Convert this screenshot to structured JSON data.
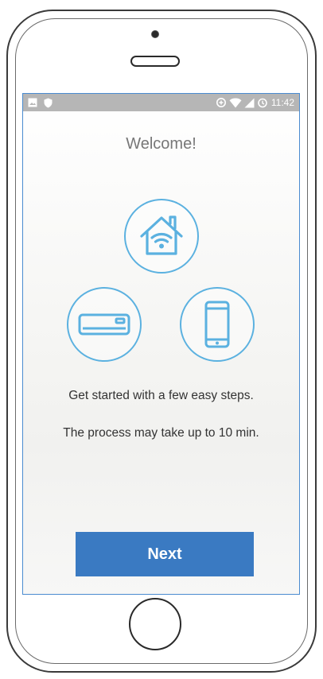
{
  "status_bar": {
    "time": "11:42",
    "left_icons": [
      "image-notification-icon",
      "shield-icon"
    ],
    "right_icons": [
      "data-saver-icon",
      "wifi-icon",
      "cellular-signal-icon",
      "alarm-icon"
    ]
  },
  "welcome": {
    "title": "Welcome!",
    "icons": [
      "wifi-home-icon",
      "air-conditioner-icon",
      "smartphone-icon"
    ],
    "message_1": "Get started with a few easy steps.",
    "message_2": "The process may take up to 10 min."
  },
  "actions": {
    "next_label": "Next"
  },
  "colors": {
    "accent": "#3a7ac2",
    "icon_stroke": "#5bb1e0",
    "status_bar": "#b6b6b6",
    "title_text": "#777777"
  }
}
